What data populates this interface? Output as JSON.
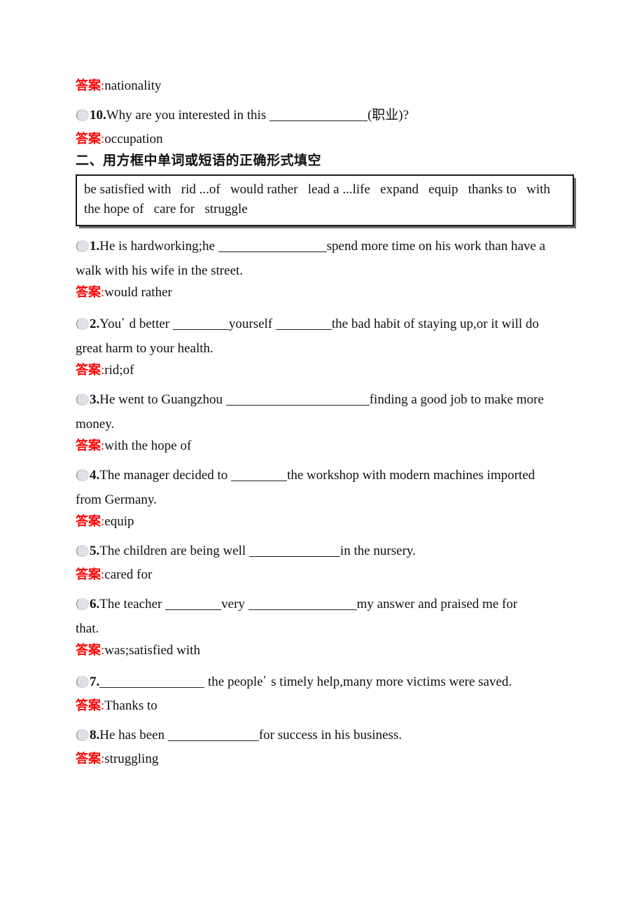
{
  "document": {
    "bullet_icon": "textured-sphere-bullet",
    "answer_label": "答案",
    "colon": ":",
    "accent_color": "#ff0000",
    "text_color": "#111111"
  },
  "top_answer": {
    "label": "答案",
    "colon": ":",
    "text": "nationality"
  },
  "question_10": {
    "number": "10.",
    "text_before": "Why are you interested in this ",
    "blank_width": 140,
    "text_after": "(职业)?",
    "answer_label": "答案",
    "answer_colon": ":",
    "answer_text": "occupation"
  },
  "section": {
    "heading": "二、用方框中单词或短语的正确形式填空",
    "wordbank": {
      "line1": "be satisfied with   rid ...of   would rather   lead a ...life   expand   equip   thanks to   with",
      "line2": "the hope of   care for   struggle",
      "words": [
        "be satisfied with",
        "rid ...of",
        "would rather",
        "lead a ...life",
        "expand",
        "equip",
        "thanks to",
        "with the hope of",
        "care for",
        "struggle"
      ]
    }
  },
  "questions": [
    {
      "number": "1.",
      "seg1": "He is hardworking;he ",
      "blank1": 155,
      "seg2": "spend more time on his work than have a",
      "cont": "walk with his wife in the street.",
      "answer_label": "答案",
      "answer_colon": ":",
      "answer_text": "would rather"
    },
    {
      "number": "2.",
      "seg1": "You",
      "apos": "’",
      "seg1b": " d better ",
      "blank1": 80,
      "seg2": "yourself ",
      "blank2": 80,
      "seg3": "the bad habit of staying up,or it will do",
      "cont": "great harm to your health.",
      "answer_label": "答案",
      "answer_colon": ":",
      "answer_text": "rid;of"
    },
    {
      "number": "3.",
      "seg1": "He went to Guangzhou ",
      "blank1": 205,
      "seg2": "finding a good job to make more",
      "cont": "money.",
      "answer_label": "答案",
      "answer_colon": ":",
      "answer_text": "with the hope of"
    },
    {
      "number": "4.",
      "seg1": "The manager decided to ",
      "blank1": 80,
      "seg2": "the workshop with modern machines imported",
      "cont": "from Germany.",
      "answer_label": "答案",
      "answer_colon": ":",
      "answer_text": "equip"
    },
    {
      "number": "5.",
      "seg1": "The children are being well ",
      "blank1": 130,
      "seg2": "in the nursery.",
      "cont": "",
      "answer_label": "答案",
      "answer_colon": ":",
      "answer_text": "cared for"
    },
    {
      "number": "6.",
      "seg1": "The teacher ",
      "blank1": 80,
      "seg2": "very ",
      "blank2": 155,
      "seg3": "my answer and praised me for",
      "cont": "that.",
      "answer_label": "答案",
      "answer_colon": ":",
      "answer_text": "was;satisfied with"
    },
    {
      "number": "7.",
      "seg1": "",
      "blank1": 150,
      "seg2": " the people",
      "apos": "’",
      "seg3": " s timely help,many more victims were saved.",
      "cont": "",
      "answer_label": "答案",
      "answer_colon": ":",
      "answer_text": "Thanks to"
    },
    {
      "number": "8.",
      "seg1": "He has been ",
      "blank1": 130,
      "seg2": "for success in his business.",
      "cont": "",
      "answer_label": "答案",
      "answer_colon": ":",
      "answer_text": "struggling"
    }
  ]
}
